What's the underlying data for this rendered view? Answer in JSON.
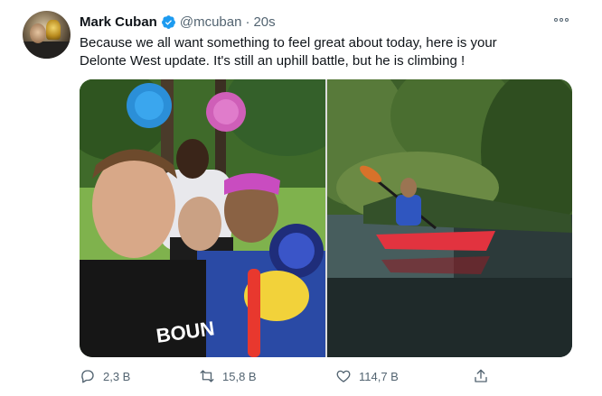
{
  "tweet": {
    "author_name": "Mark Cuban",
    "handle": "@mcuban",
    "separator": "·",
    "time": "20s",
    "text": "Because we all want something to feel great about today, here is your\nDelonte West update.  It's still an uphill battle, but he is climbing !",
    "photo_text": "BOUN"
  },
  "actions": {
    "replies": "2,3 В",
    "retweets": "15,8 В",
    "likes": "114,7 В"
  },
  "icons": {
    "verified": "verified-badge-icon",
    "more": "more-options-icon",
    "reply": "reply-icon",
    "retweet": "retweet-icon",
    "like": "heart-icon",
    "share": "share-icon"
  },
  "colors": {
    "verified": "#1d9bf0",
    "secondary_text": "#536471",
    "primary_text": "#0f1419"
  }
}
